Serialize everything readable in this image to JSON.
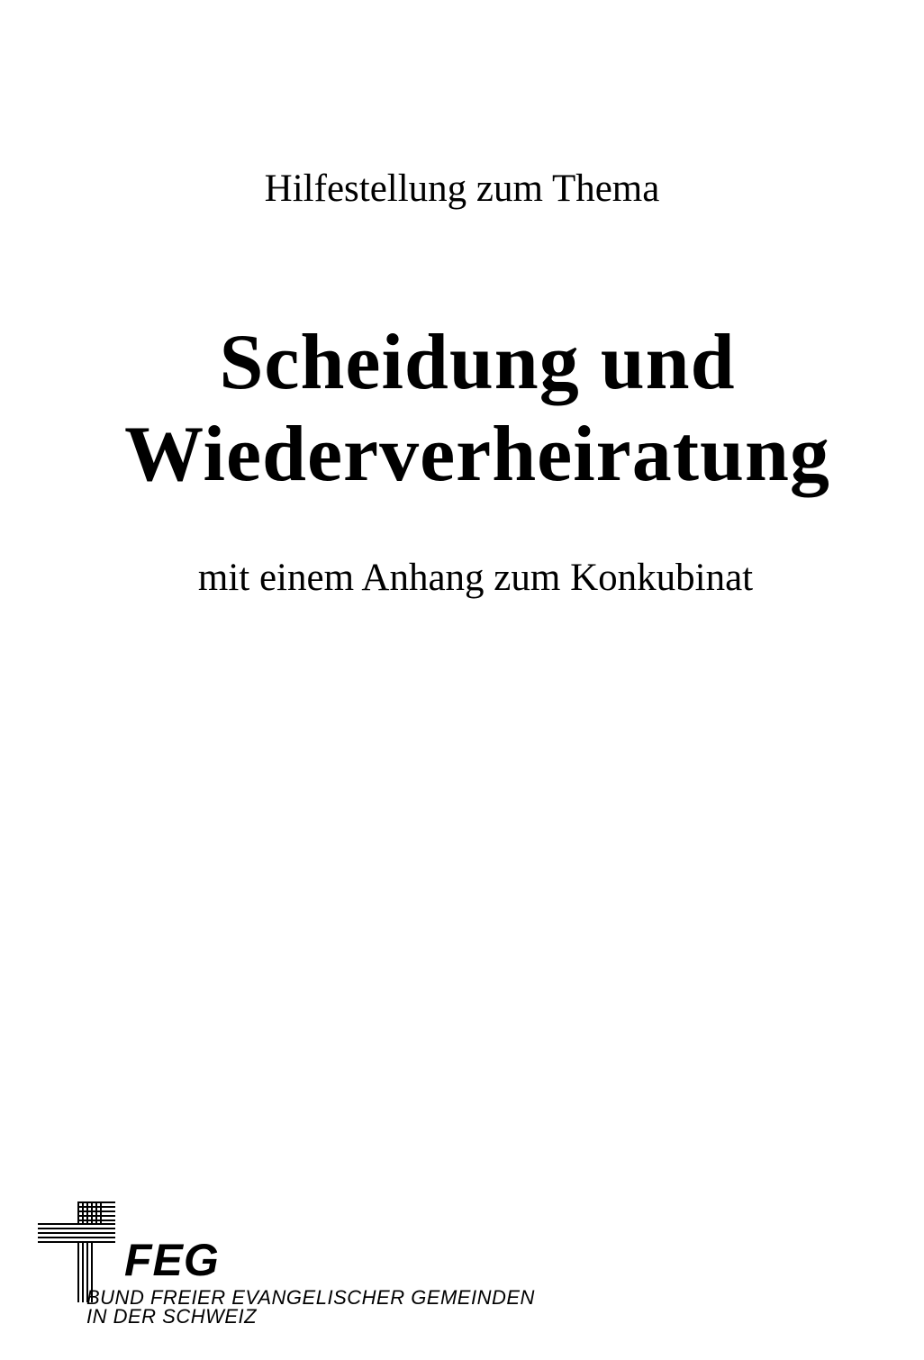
{
  "document": {
    "kicker": "Hilfestellung zum Thema",
    "title_line_1": "Scheidung und",
    "title_line_2": "Wiederverheiratung",
    "subtitle": "mit einem Anhang zum Konkubinat"
  },
  "logo": {
    "icon": "striped-cross-icon",
    "abbreviation": "FEG",
    "name_line_1": "BUND FREIER EVANGELISCHER GEMEINDEN",
    "name_line_2": "IN DER SCHWEIZ"
  }
}
